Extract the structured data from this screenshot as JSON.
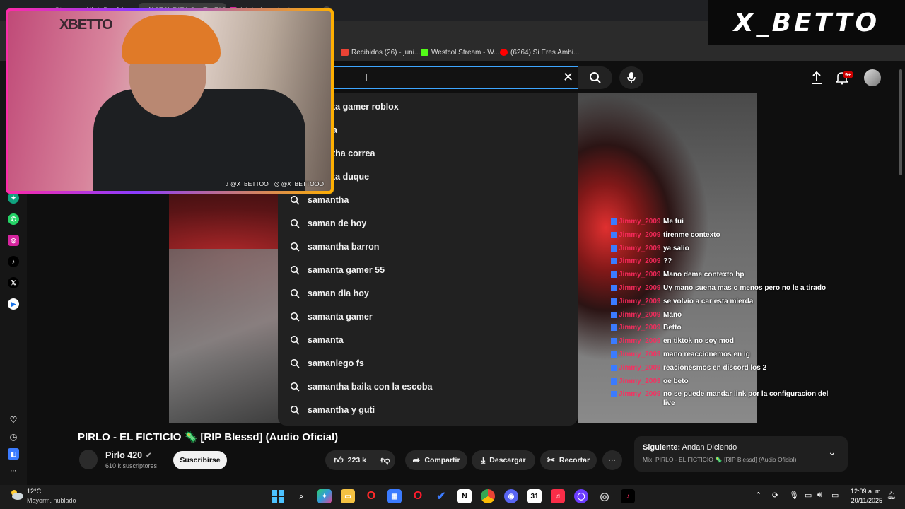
{
  "browser": {
    "tabs": [
      "Stream - Kick Dashboard",
      "(1276) PIRLO - EL FICTICIO",
      "Historias • Instagram"
    ],
    "bookmarks": [
      "Recibidos (26) - juni...",
      "Westcol Stream - W...",
      "(6264) Si Eres Ambi..."
    ]
  },
  "search": {
    "suggestions": [
      "ta gamer roblox",
      "a",
      "tha correa",
      "ta duque",
      "samantha",
      "saman de hoy",
      "samantha barron",
      "samanta gamer 55",
      "saman dia hoy",
      "samanta gamer",
      "samanta",
      "samaniego fs",
      "samantha baila con la escoba",
      "samantha y guti"
    ]
  },
  "header": {
    "notifications_badge": "9+"
  },
  "chat": {
    "username": "Jimmy_2009",
    "messages": [
      "Me fui",
      "tirenme contexto",
      "ya salio",
      "??",
      "Mano deme contexto hp",
      "Uy mano suena mas o menos pero no le a tirado",
      "se volvio a car esta mierda",
      "Mano",
      "Betto",
      "en tiktok no soy mod",
      "mano reaccionemos en ig",
      "reacionesmos en discord los 2",
      "oe beto",
      "no se puede mandar link por la configuracion del live"
    ]
  },
  "video": {
    "title": "PIRLO - EL FICTICIO 🦠 [RIP Blessd] (Audio Oficial)",
    "channel": "Pirlo 420",
    "subscribers": "610 k suscriptores",
    "subscribe_label": "Suscribirse",
    "likes": "223 k",
    "share_label": "Compartir",
    "download_label": "Descargar",
    "clip_label": "Recortar"
  },
  "next": {
    "label_prefix": "Siguiente:",
    "label_title": "Andan Diciendo",
    "mix": "Mix: PIRLO - EL FICTICIO 🦠 [RIP Blessd] (Audio Oficial)"
  },
  "webcam": {
    "logo": "XBETTO",
    "tiktok": "@X_BETTOO",
    "instagram": "@X_BETTOOO"
  },
  "brand": "X_BETTO",
  "taskbar": {
    "weather_temp": "12°C",
    "weather_desc": "Mayorm. nublado",
    "time": "12:09 a. m.",
    "date": "20/11/2025"
  },
  "colors": {
    "accent_blue": "#3ea6ff",
    "chat_user": "#ff2a5f",
    "youtube_red": "#ff0000"
  }
}
